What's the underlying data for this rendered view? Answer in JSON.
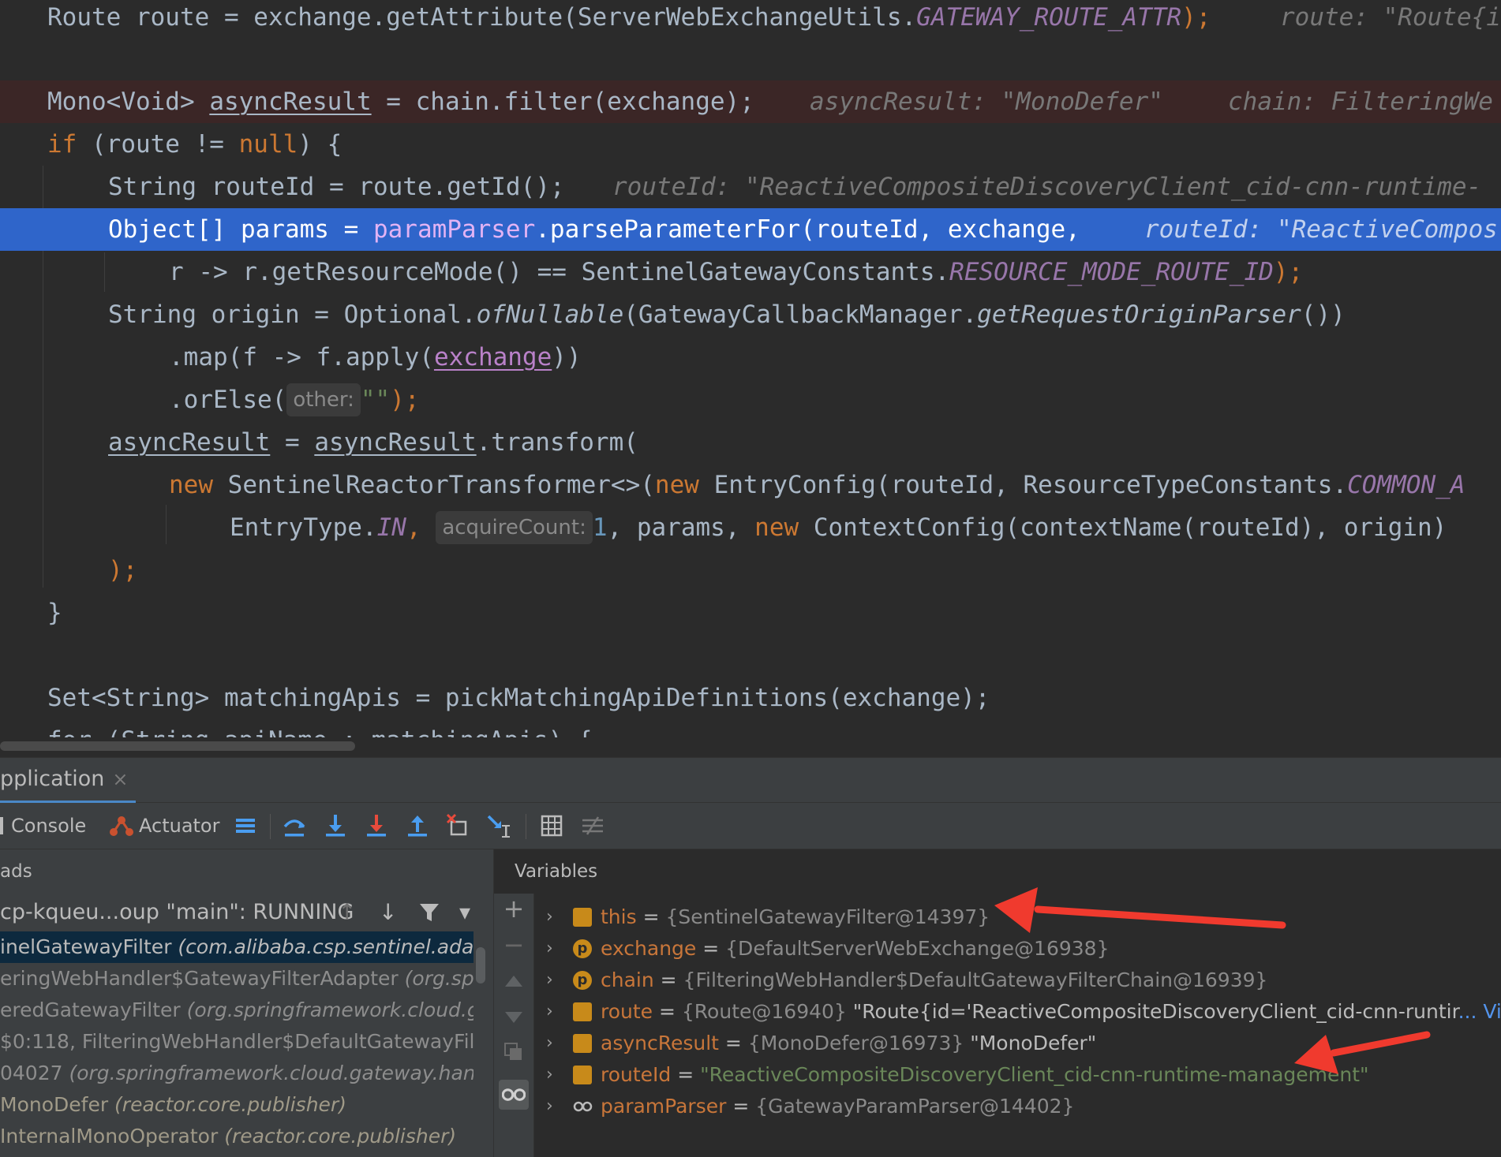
{
  "editor": {
    "lines": [
      {
        "parts": [
          "Route route = exchange.getAttribute(ServerWebExchangeUtils.",
          "GATEWAY_ROUTE_ATTR",
          ");",
          "route: \"Route{i"
        ]
      },
      {
        "parts": [
          "Mono<Void> ",
          "asyncResult",
          " = chain.filter(exchange);",
          "asyncResult: \"MonoDefer\"",
          "chain: FilteringWe"
        ]
      },
      {
        "parts": [
          "if",
          " (route != ",
          "null",
          ") {"
        ]
      },
      {
        "parts": [
          "String routeId = route.getId();",
          "routeId: \"ReactiveCompositeDiscoveryClient_cid-cnn-runtime-"
        ]
      },
      {
        "parts": [
          "Object[] params = ",
          "paramParser",
          ".parseParameterFor(routeId, exchange,",
          "routeId: \"ReactiveCompos"
        ]
      },
      {
        "parts": [
          "r -> r.getResourceMode() == SentinelGatewayConstants.",
          "RESOURCE_MODE_ROUTE_ID",
          ");"
        ]
      },
      {
        "parts": [
          "String origin = Optional.",
          "ofNullable",
          "(GatewayCallbackManager.",
          "getRequestOriginParser",
          "())"
        ]
      },
      {
        "parts": [
          ".map(f -> f.apply(",
          "exchange",
          "))"
        ]
      },
      {
        "parts": [
          ".orElse(",
          "other:",
          "\"\"",
          ");"
        ]
      },
      {
        "parts": [
          "asyncResult",
          " = ",
          "asyncResult",
          ".transform("
        ]
      },
      {
        "parts": [
          "new",
          " SentinelReactorTransformer<>(",
          "new",
          " EntryConfig(routeId, ResourceTypeConstants.",
          "COMMON_A"
        ]
      },
      {
        "parts": [
          "EntryType.",
          "IN",
          ",",
          "acquireCount:",
          "1",
          ", params, ",
          "new",
          " ContextConfig(contextName(routeId), origin)"
        ]
      },
      {
        "parts": [
          ");"
        ]
      },
      {
        "parts": [
          "}"
        ]
      },
      {
        "parts": [
          "Set<String> matchingApis = pickMatchingApiDefinitions(exchange);"
        ]
      },
      {
        "parts": [
          "for (String apiName : matchingApis) {"
        ]
      }
    ]
  },
  "panel": {
    "tab_label": "pplication",
    "toolbar": {
      "console": "Console",
      "actuator": "Actuator"
    },
    "frames": {
      "header": "ads",
      "thread": "cp-kqueu...oup \"main\": RUNNING",
      "items": [
        {
          "name": "inelGatewayFilter ",
          "pkg": "(com.alibaba.csp.sentinel.ada"
        },
        {
          "name": "eringWebHandler$GatewayFilterAdapter ",
          "pkg": "(org.sp"
        },
        {
          "name": "eredGatewayFilter ",
          "pkg": "(org.springframework.cloud.g"
        },
        {
          "name": "$0:118, FilteringWebHandler$DefaultGatewayFil",
          "pkg": ""
        },
        {
          "name": "04027 ",
          "pkg": "(org.springframework.cloud.gateway.han"
        },
        {
          "name": " MonoDefer ",
          "pkg": "(reactor.core.publisher)"
        },
        {
          "name": " InternalMonoOperator ",
          "pkg": "(reactor.core.publisher)"
        }
      ]
    },
    "variables": {
      "header": "Variables",
      "items": [
        {
          "name": "this",
          "eq": " = ",
          "value": "{SentinelGatewayFilter@14397}",
          "extra": "",
          "link": ""
        },
        {
          "name": "exchange",
          "eq": " = ",
          "value": "{DefaultServerWebExchange@16938}",
          "extra": "",
          "link": ""
        },
        {
          "name": "chain",
          "eq": " = ",
          "value": "{FilteringWebHandler$DefaultGatewayFilterChain@16939}",
          "extra": "",
          "link": ""
        },
        {
          "name": "route",
          "eq": " = ",
          "value": "{Route@16940}",
          "extra": " \"Route{id='ReactiveCompositeDiscoveryClient_cid-cnn-runtir",
          "link": "... View"
        },
        {
          "name": "asyncResult",
          "eq": " = ",
          "value": "{MonoDefer@16973}",
          "extra": " \"MonoDefer\"",
          "link": ""
        },
        {
          "name": "routeId",
          "eq": " = ",
          "value": "",
          "extra": "\"ReactiveCompositeDiscoveryClient_cid-cnn-runtime-management\"",
          "link": ""
        },
        {
          "name": "paramParser",
          "eq": " = ",
          "value": "{GatewayParamParser@14402}",
          "extra": "",
          "link": ""
        }
      ]
    }
  },
  "icons": {
    "tab_close": "×",
    "console": "console-icon",
    "actuator": "actuator-icon",
    "chevron": "›",
    "add": "+",
    "remove": "−",
    "arrow_up": "↑",
    "arrow_down": "↓",
    "filter": "filter-icon",
    "dropdown": "▾"
  },
  "colors": {
    "editor_bg": "#2b2b2b",
    "selection": "#2f65ca",
    "error_line": "#3b2626",
    "keyword": "#cc7832",
    "field": "#9876aa",
    "annotation_arrow": "#f03a2e"
  }
}
